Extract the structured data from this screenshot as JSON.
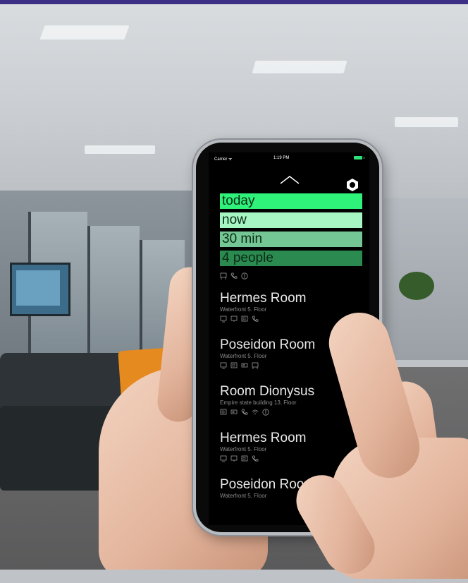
{
  "status_bar": {
    "carrier": "Carrier ᯤ",
    "time": "1:19 PM"
  },
  "filters": {
    "date": "today",
    "start": "now",
    "duration": "30 min",
    "capacity": "4 people"
  },
  "filter_amenity_icons": [
    "whiteboard-icon",
    "phone-icon",
    "accessibility-icon"
  ],
  "rooms": [
    {
      "name": "Hermes Room",
      "location": "Waterfront 5. Floor",
      "amenities": [
        "display-icon",
        "screen-icon",
        "video-icon",
        "phone-icon"
      ]
    },
    {
      "name": "Poseidon Room",
      "location": "Waterfront 5. Floor",
      "amenities": [
        "display-icon",
        "video-icon",
        "projector-icon",
        "whiteboard-icon"
      ]
    },
    {
      "name": "Room Dionysus",
      "location": "Empire state building 13. Floor",
      "amenities": [
        "video-icon",
        "projector-icon",
        "phone-icon",
        "wifi-icon",
        "accessibility-icon"
      ]
    },
    {
      "name": "Hermes Room",
      "location": "Waterfront 5. Floor",
      "amenities": [
        "display-icon",
        "screen-icon",
        "video-icon",
        "phone-icon"
      ]
    },
    {
      "name": "Poseidon Room",
      "location": "Waterfront 5. Floor",
      "amenities": []
    }
  ],
  "colors": {
    "filter_today": "#2ef27a",
    "filter_now": "#a6f6c4",
    "filter_duration": "#74c794",
    "filter_people": "#2a8a4f",
    "battery": "#30e07b"
  }
}
